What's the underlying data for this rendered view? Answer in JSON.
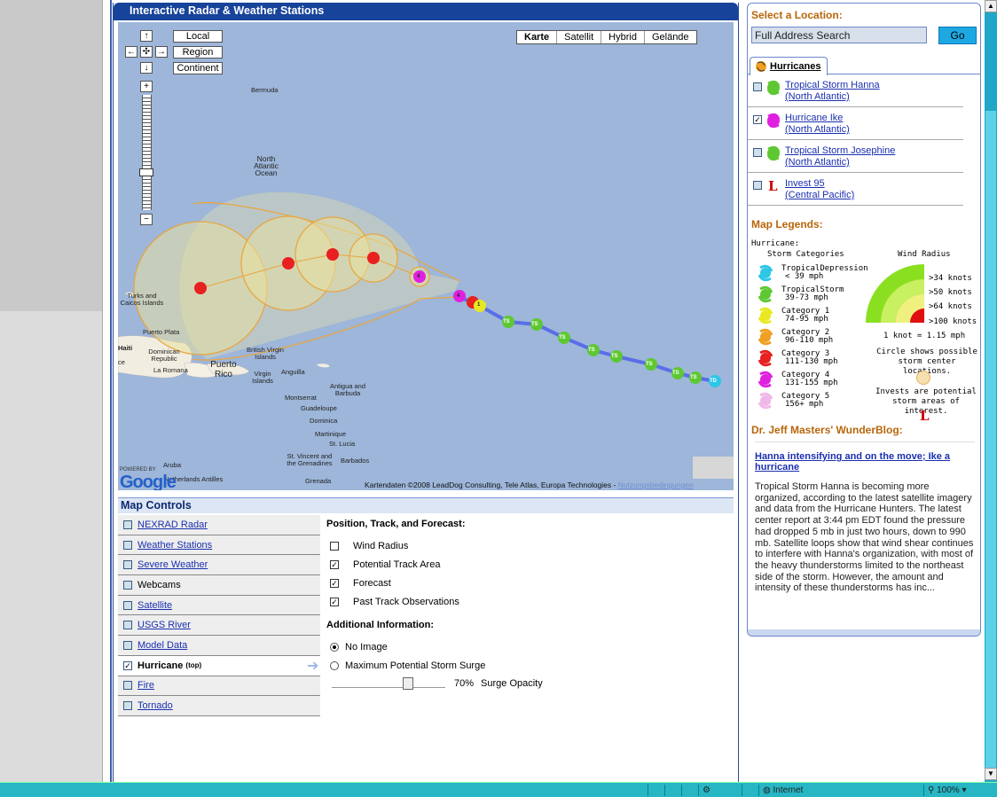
{
  "radar_title": "Interactive Radar & Weather Stations",
  "map": {
    "nav": {
      "up": "↑",
      "down": "↓",
      "left": "←",
      "right": "→",
      "center": "✣",
      "zoom_in": "+",
      "zoom_out": "−"
    },
    "scale_buttons": [
      "Local",
      "Region",
      "Continent"
    ],
    "type_buttons": [
      "Karte",
      "Satellit",
      "Hybrid",
      "Gelände"
    ],
    "labels": {
      "bermuda": "Bermuda",
      "ocean": "North Atlantic Ocean",
      "turks": "Turks and Caicos Islands",
      "puerto_plata": "Puerto Plata",
      "haiti": "Haiti",
      "dominican": "Dominican Republic",
      "la_romana": "La Romana",
      "puerto_rico": "Puerto Rico",
      "bvi": "British Virgin Islands",
      "virgin": "Virgin Islands",
      "anguilla": "Anguilla",
      "antigua": "Antigua and Barbuda",
      "montserrat": "Montserrat",
      "guadeloupe": "Guadeloupe",
      "dominica": "Dominica",
      "martinique": "Martinique",
      "st_lucia": "St. Lucia",
      "st_vincent": "St. Vincent and the Grenadines",
      "barbados": "Barbados",
      "grenada": "Grenada",
      "aruba": "Aruba",
      "antilles": "Netherlands Antilles",
      "ce": "ce"
    },
    "google": "Google",
    "powered": "POWERED BY",
    "copyright": "Kartendaten ©2008 LeadDog Consulting, Tele Atlas, Europa Technologies - ",
    "terms": "Nutzungsbedingungen",
    "track_labels": [
      "TS",
      "TS",
      "TS",
      "TS",
      "TS",
      "TS",
      "TS",
      "TS",
      "TD",
      "1",
      "4",
      "4"
    ]
  },
  "map_controls": {
    "title": "Map Controls",
    "layers": [
      {
        "label": "NEXRAD Radar",
        "checked": false
      },
      {
        "label": "Weather Stations",
        "checked": false
      },
      {
        "label": "Severe Weather",
        "checked": false
      },
      {
        "label": "Webcams",
        "checked": false
      },
      {
        "label": "Satellite",
        "checked": false
      },
      {
        "label": "USGS River",
        "checked": false
      },
      {
        "label": "Model Data",
        "checked": false
      },
      {
        "label": "Hurricane",
        "suffix": "(top)",
        "checked": true
      },
      {
        "label": "Fire",
        "checked": false
      },
      {
        "label": "Tornado",
        "checked": false
      }
    ],
    "position_title": "Position, Track, and Forecast:",
    "options": [
      {
        "label": "Wind Radius",
        "checked": false
      },
      {
        "label": "Potential Track Area",
        "checked": true
      },
      {
        "label": "Forecast",
        "checked": true
      },
      {
        "label": "Past Track Observations",
        "checked": true
      }
    ],
    "additional_title": "Additional Information:",
    "radios": [
      {
        "label": "No Image",
        "selected": true
      },
      {
        "label": "Maximum Potential Storm Surge",
        "selected": false
      }
    ],
    "opacity_value": "70%",
    "opacity_label": "Surge Opacity"
  },
  "sidebar": {
    "select_title": "Select a Location:",
    "search_value": "Full Address Search",
    "go": "Go",
    "tab": "Hurricanes",
    "storms": [
      {
        "name": "Tropical Storm Hanna",
        "region": "(North Atlantic)",
        "checked": false,
        "badge": "TS",
        "color": "#5ec832"
      },
      {
        "name": "Hurricane Ike",
        "region": "(North Atlantic)",
        "checked": true,
        "badge": "4",
        "color": "#e020e0"
      },
      {
        "name": "Tropical Storm Josephine",
        "region": "(North Atlantic)",
        "checked": false,
        "badge": "TS",
        "color": "#5ec832"
      },
      {
        "name": "Invest 95",
        "region": "(Central Pacific)",
        "checked": false,
        "badge": "L",
        "color": "#d00000"
      }
    ],
    "legend_title": "Map Legends:",
    "legend_hurricane": "Hurricane:",
    "storm_categories": "Storm Categories",
    "wind_radius": "Wind Radius",
    "categories": [
      {
        "name": "TropicalDepression",
        "range": "< 39 mph",
        "color": "#2cc6e6"
      },
      {
        "name": "TropicalStorm",
        "range": "39-73 mph",
        "color": "#5ec832"
      },
      {
        "name": "Category 1",
        "range": "74-95 mph",
        "color": "#e8e820"
      },
      {
        "name": "Category 2",
        "range": "96-110 mph",
        "color": "#f0a020"
      },
      {
        "name": "Category 3",
        "range": "111-130 mph",
        "color": "#e82020"
      },
      {
        "name": "Category 4",
        "range": "131-155 mph",
        "color": "#e020e0"
      },
      {
        "name": "Category 5",
        "range": "156+ mph",
        "color": "#f0b8e8"
      }
    ],
    "radii": [
      ">34 knots",
      ">50 knots",
      ">64 knots",
      ">100 knots"
    ],
    "knot": "1 knot = 1.15 mph",
    "circle_note": "Circle shows possible storm center locations.",
    "invest_note": "Invests are potential storm areas of interest.",
    "blog_title": "Dr. Jeff Masters' WunderBlog:",
    "blog_link": "Hanna intensifying and on the move; Ike a hurricane",
    "blog_text": "Tropical Storm Hanna is becoming more organized, according to the latest satellite imagery and data from the Hurricane Hunters. The latest center report at 3:44 pm EDT found the pressure had dropped 5 mb in just two hours, down to 990 mb. Satellite loops show that wind shear continues to interfere with Hanna's organization, with most of the heavy thunderstorms limited to the northeast side of the storm. However, the amount and intensity of these thunderstorms has inc..."
  },
  "statusbar": {
    "zone": "Internet",
    "zoom": "100%"
  }
}
